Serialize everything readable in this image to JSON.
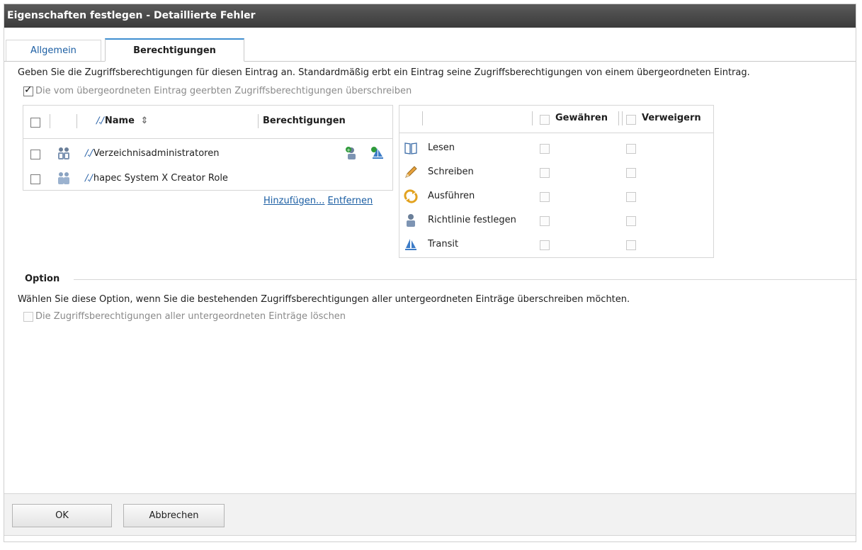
{
  "window": {
    "title": "Eigenschaften festlegen - Detaillierte Fehler"
  },
  "tabs": [
    {
      "label": "Allgemein",
      "active": false
    },
    {
      "label": "Berechtigungen",
      "active": true
    }
  ],
  "description": "Geben Sie die Zugriffsberechtigungen für diesen Eintrag an. Standardmäßig erbt ein Eintrag seine Zugriffsberechtigungen von einem übergeordneten Eintrag.",
  "override_inherited": {
    "label": "Die vom übergeordneten Eintrag geerbten Zugriffsberechtigungen überschreiben",
    "checked": true
  },
  "acl_table": {
    "columns": {
      "name": "Name",
      "rights": "Berechtigungen"
    },
    "rows": [
      {
        "name": "Verzeichnisadministratoren",
        "checked": false,
        "icons": [
          "user-policy-icon",
          "transit-icon"
        ]
      },
      {
        "name": "hapec System X Creator Role",
        "checked": false,
        "icons": []
      }
    ],
    "add_link": "Hinzufügen...",
    "remove_link": "Entfernen"
  },
  "permissions_table": {
    "columns": {
      "grant": "Gewähren",
      "deny": "Verweigern"
    },
    "rows": [
      {
        "label": "Lesen",
        "icon": "book-icon",
        "grant": false,
        "deny": false
      },
      {
        "label": "Schreiben",
        "icon": "pencil-icon",
        "grant": false,
        "deny": false
      },
      {
        "label": "Ausführen",
        "icon": "execute-icon",
        "grant": false,
        "deny": false
      },
      {
        "label": "Richtlinie festlegen",
        "icon": "user-policy-icon",
        "grant": false,
        "deny": false
      },
      {
        "label": "Transit",
        "icon": "sailboat-icon",
        "grant": false,
        "deny": false
      }
    ]
  },
  "option": {
    "title": "Option",
    "description": "Wählen Sie diese Option, wenn Sie die bestehenden Zugriffsberechtigungen aller untergeordneten Einträge überschreiben möchten.",
    "clear_children": {
      "label": "Die Zugriffsberechtigungen aller untergeordneten Einträge löschen",
      "checked": false
    }
  },
  "buttons": {
    "ok": "OK",
    "cancel": "Abbrechen"
  },
  "colors": {
    "titlebar": "#3b3b3b",
    "link": "#1b5ea3",
    "tab_accent": "#3f8fd0"
  }
}
